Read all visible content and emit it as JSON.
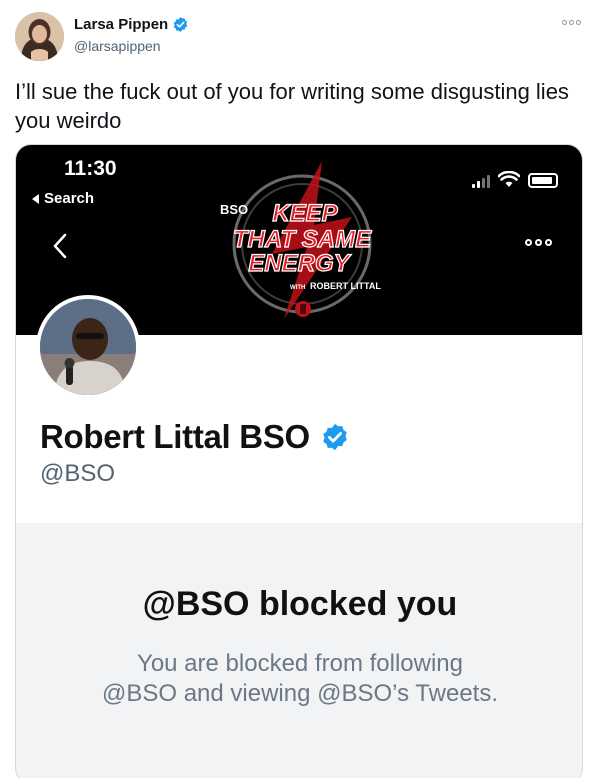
{
  "tweet": {
    "author_name": "Larsa Pippen",
    "author_handle": "@larsapippen",
    "verified": true,
    "text": "I’ll sue the fuck out of you for writing some disgusting lies you weirdo"
  },
  "screenshot": {
    "status_time": "11:30",
    "back_label": "Search",
    "banner": {
      "logo_prefix": "BSO",
      "logo_line1": "KEEP",
      "logo_line2": "THAT SAME",
      "logo_line3": "ENERGY",
      "logo_with": "WITH",
      "logo_host": "ROBERT LITTAL"
    },
    "profile": {
      "name": "Robert Littal BSO",
      "handle": "@BSO",
      "verified": true
    },
    "blocked": {
      "title": "@BSO blocked you",
      "description_line1": "You are blocked from following",
      "description_line2": "@BSO and viewing @BSO’s Tweets."
    }
  },
  "colors": {
    "verified_blue": "#1d9bf0",
    "logo_red": "#e31b23",
    "text_muted": "#536471"
  },
  "icons": [
    "more-icon",
    "verified-badge-icon",
    "wifi-icon",
    "battery-icon",
    "signal-icon",
    "chevron-left-icon"
  ]
}
